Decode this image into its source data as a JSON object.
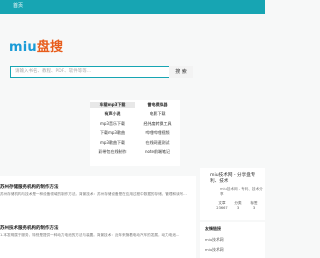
{
  "topbar": {
    "home_label": "首页"
  },
  "logo": {
    "latin": "miu",
    "chinese": "盘搜"
  },
  "search": {
    "placeholder": "请输入书名、教程、PDF、软件等等…",
    "button_label": "搜 索"
  },
  "quick_links": {
    "rows": [
      [
        "车载mp3下载",
        "雷电模拟器"
      ],
      [
        "有声小说",
        "电影下载"
      ],
      [
        "mp3音乐下载",
        "经纬度转换工具"
      ],
      [
        "下载mp3歌曲",
        "哔哩哔哩视频"
      ],
      [
        "mp3歌曲下载",
        "在线网速测试"
      ],
      [
        "彩带包在线制作",
        "note前端笔记"
      ]
    ]
  },
  "articles": [
    {
      "title": "苏州存储服务机构的制作方法",
      "desc": "苏州存储机构与技术是一种设备领域的制作方法。背景技术：苏州存储设备是在应用过程中数据的存储、管理和读写..."
    },
    {
      "title": "苏州技术服务机构的制作方法",
      "desc": "1.本发明属于服务，特别是提供一种动力电池的方法与装置。背景技术：近年来随着电动汽车的发展，动力电池..."
    }
  ],
  "profile": {
    "title": "miu技术网 - 分享盘专利、技术",
    "subtitle": "miu技术网 - 专利、技术分享",
    "stats": [
      {
        "label": "文章",
        "value": "23667"
      },
      {
        "label": "分类",
        "value": "3"
      },
      {
        "label": "标签",
        "value": "3"
      }
    ]
  },
  "links": {
    "title": "友情链接",
    "items": [
      "miu技术网",
      "miu技术网"
    ]
  }
}
